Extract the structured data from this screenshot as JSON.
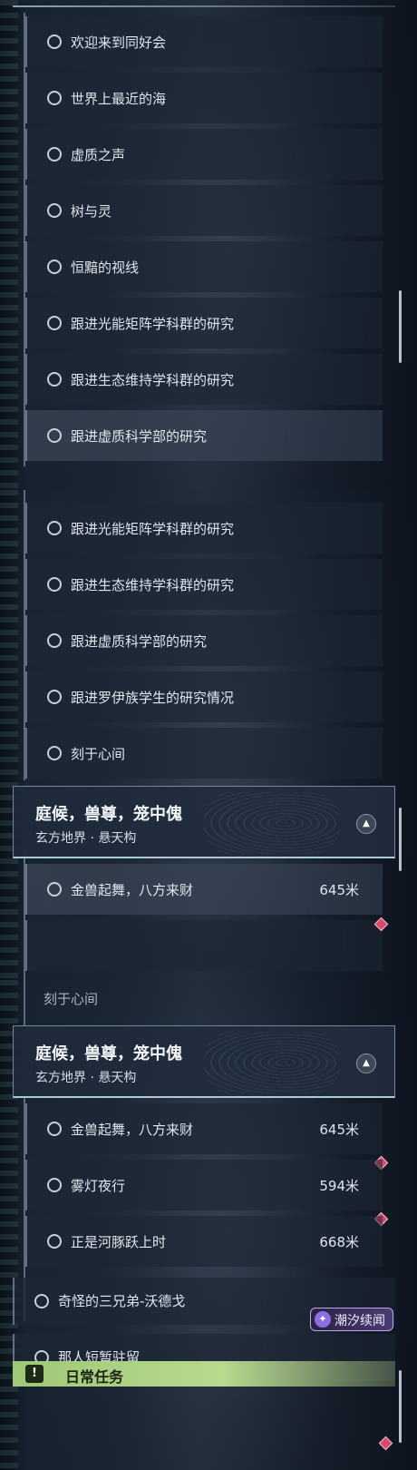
{
  "panel1": {
    "items": [
      {
        "label": "欢迎来到同好会"
      },
      {
        "label": "世界上最近的海"
      },
      {
        "label": "虚质之声"
      },
      {
        "label": "树与灵"
      },
      {
        "label": "恒黯的视线"
      },
      {
        "label": "跟进光能矩阵学科群的研究"
      },
      {
        "label": "跟进生态维持学科群的研究"
      },
      {
        "label": "跟进虚质科学部的研究"
      }
    ]
  },
  "panel2": {
    "items": [
      {
        "label": "跟进光能矩阵学科群的研究"
      },
      {
        "label": "跟进生态维持学科群的研究"
      },
      {
        "label": "跟进虚质科学部的研究"
      },
      {
        "label": "跟进罗伊族学生的研究情况"
      },
      {
        "label": "刻于心间"
      }
    ],
    "group": {
      "title": "庭候，兽尊，笼中傀",
      "subtitle": "玄方地界 · 悬天构"
    },
    "subitems": [
      {
        "label": "金兽起舞，八方来财",
        "distance": "645米"
      }
    ]
  },
  "panel3": {
    "partial_label": "刻于心间",
    "group": {
      "title": "庭候，兽尊，笼中傀",
      "subtitle": "玄方地界 · 悬天构"
    },
    "subitems": [
      {
        "label": "金兽起舞，八方来财",
        "distance": "645米"
      },
      {
        "label": "雾灯夜行",
        "distance": "594米"
      },
      {
        "label": "正是河豚跃上时",
        "distance": "668米"
      }
    ],
    "quests": [
      {
        "label": "奇怪的三兄弟-沃德戈"
      },
      {
        "label": "那人短暂驻留"
      }
    ],
    "badge": {
      "text": "潮汐续闻"
    },
    "daily": {
      "label": "日常任务",
      "icon": "!"
    }
  }
}
